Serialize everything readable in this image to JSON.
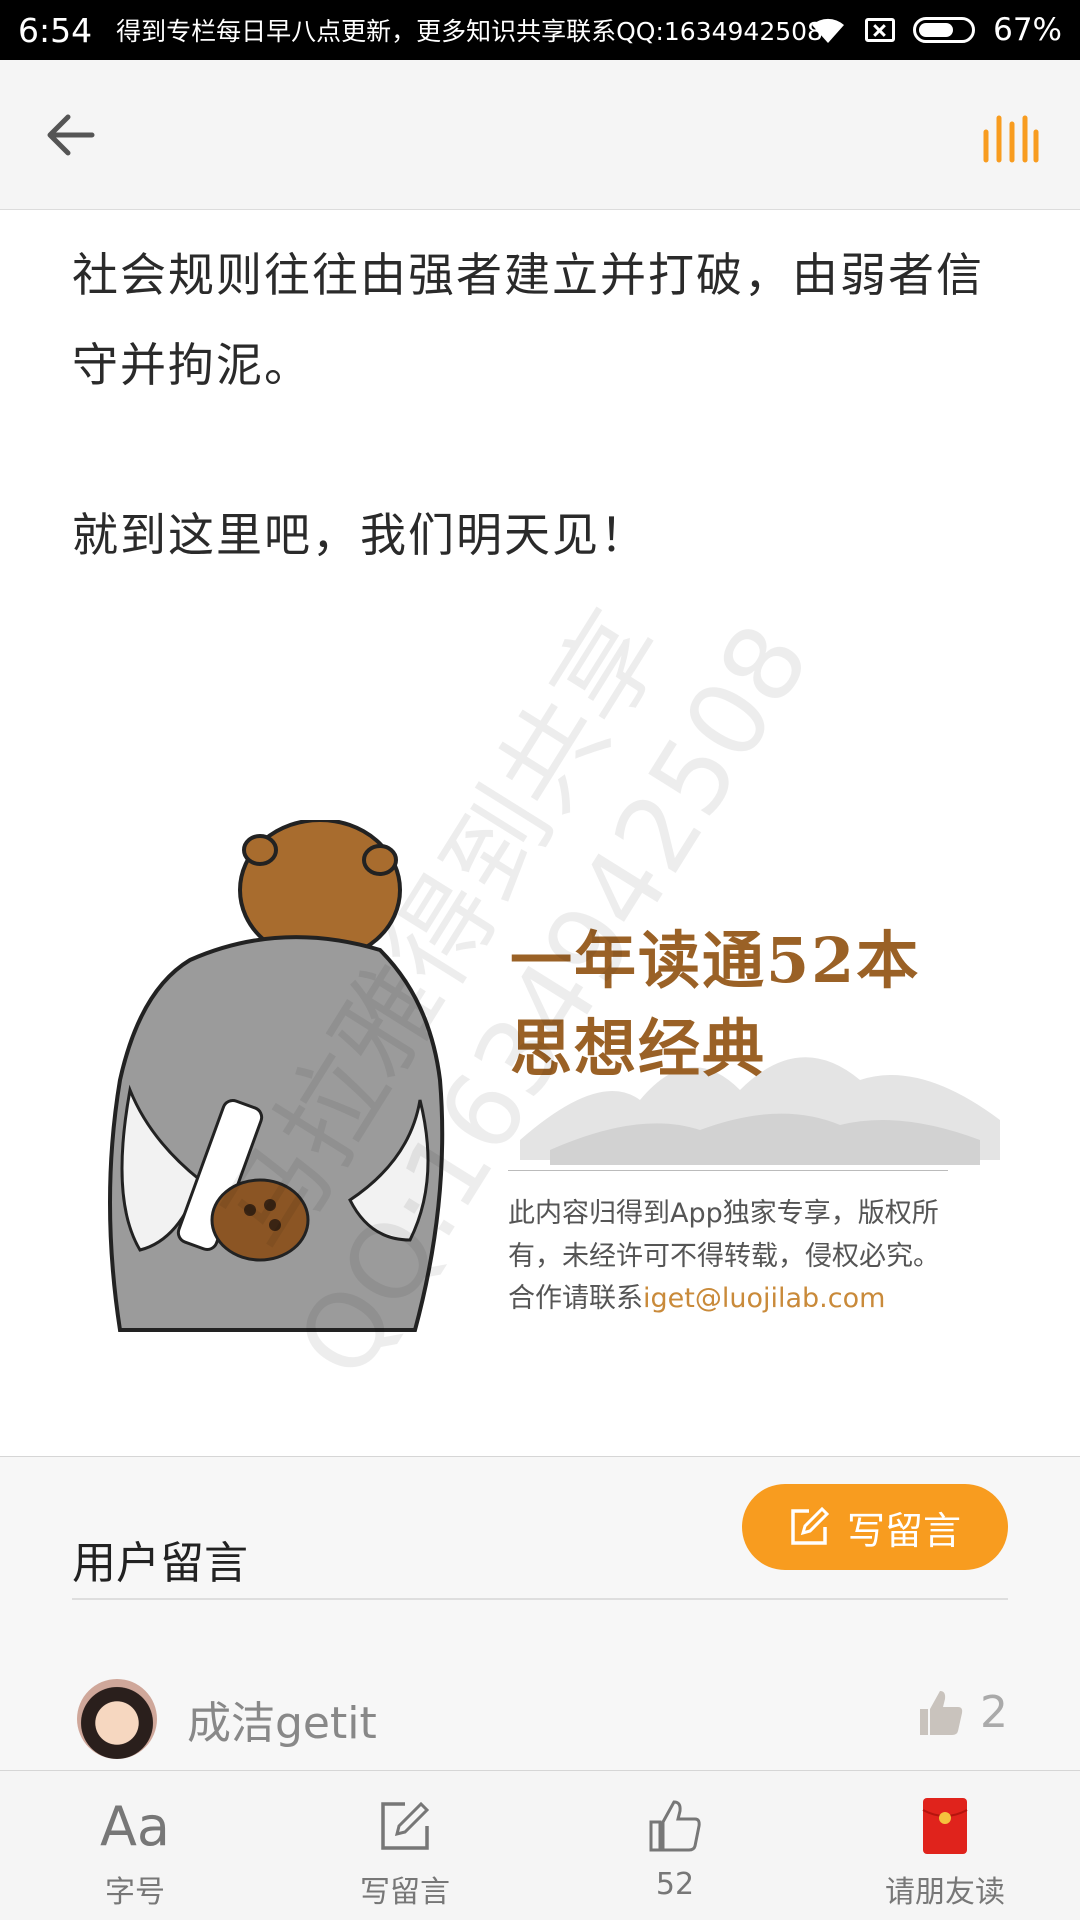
{
  "status_bar": {
    "time": "6:54",
    "notification": "得到专栏每日早八点更新，更多知识共享联系QQ:1634942508",
    "battery_percent": "67%",
    "battery_level": 0.67
  },
  "top_bar": {
    "back_icon": "arrow-left-icon",
    "audio_icon": "audio-bars-icon",
    "accent_color": "#f89c1f"
  },
  "article": {
    "paragraphs": [
      "社会规则往往由强者建立并打破，由弱者信守并拘泥。",
      "就到这里吧，我们明天见！"
    ]
  },
  "poster": {
    "headline_line1": "一年读通52本",
    "headline_line2": "思想经典",
    "copyright": "此内容归得到App独家专享，版权所有，未经许可不得转载，侵权必究。",
    "contact_prefix": "合作请联系",
    "contact_email": "iget@luojilab.com",
    "headline_color": "#9a6126"
  },
  "watermark": {
    "line1": "马拉雅得到共享",
    "line2": "QQ:1634942508"
  },
  "comments": {
    "title": "用户留言",
    "write_button_label": "写留言",
    "items": [
      {
        "user": "成洁getit",
        "likes": "2"
      }
    ]
  },
  "bottom_nav": {
    "items": [
      {
        "icon_text": "Aa",
        "label": "字号",
        "icon": "font-size-icon"
      },
      {
        "label": "写留言",
        "icon": "edit-icon"
      },
      {
        "label": "52",
        "icon": "thumbs-up-icon"
      },
      {
        "label": "请朋友读",
        "icon": "red-envelope-icon"
      }
    ]
  }
}
